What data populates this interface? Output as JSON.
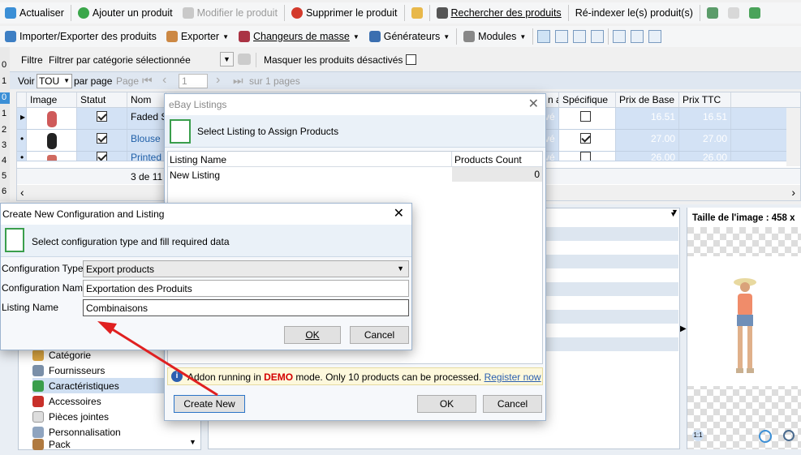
{
  "toolbar1": {
    "refresh": "Actualiser",
    "add": "Ajouter un produit",
    "edit": "Modifier le produit",
    "delete": "Supprimer le produit",
    "search": "Rechercher des produits",
    "reindex": "Ré-indexer le(s) produit(s)"
  },
  "toolbar2": {
    "import_export": "Importer/Exporter des produits",
    "export": "Exporter",
    "mass": "Changeurs de masse",
    "generators": "Générateurs",
    "modules": "Modules"
  },
  "filter": {
    "label": "Filtre",
    "value": "Filtrer par catégorie sélectionnée",
    "hide_disabled": "Masquer les produits désactivés"
  },
  "pager": {
    "show": "Voir",
    "per_value": "TOU",
    "per_page": "par page",
    "page_label": "Page",
    "page_value": "1",
    "of_pages": "sur 1 pages"
  },
  "grid": {
    "columns": [
      "Image",
      "Statut",
      "Nom",
      "n avancée des sto",
      "Spécifique",
      "Prix de Base",
      "Prix TTC"
    ],
    "rows": [
      {
        "name": "Faded Sh",
        "state": "vé",
        "spec": false,
        "base": "16.51",
        "ttc": "16.51"
      },
      {
        "name": "Blouse",
        "state": "vé",
        "spec": true,
        "base": "27.00",
        "ttc": "27.00"
      },
      {
        "name": "Printed D",
        "state": "vé",
        "spec": false,
        "base": "26.00",
        "ttc": "26.00"
      }
    ],
    "footer": "3 de 11 P",
    "left_nums": [
      "0",
      "1",
      "0",
      "1",
      "2",
      "3",
      "4",
      "5",
      "6"
    ]
  },
  "ebay": {
    "title": "eBay Listings",
    "header": "Select Listing to Assign Products",
    "col_name": "Listing Name",
    "col_count": "Products Count",
    "row_name": "New Listing",
    "row_count": "0",
    "notice_pre": "Addon running in ",
    "notice_demo": "DEMO",
    "notice_post": " mode. Only 10 products can be processed.",
    "notice_link": "Register now",
    "create_new": "Create New",
    "ok": "OK",
    "cancel": "Cancel"
  },
  "config": {
    "title": "Create New Configuration and Listing",
    "header": "Select configuration type and fill required data",
    "type_label": "Configuration Type",
    "type_value": "Export products",
    "name_label": "Configuration Name",
    "name_value": "Exportation des Produits",
    "listing_label": "Listing Name",
    "listing_value": "Combinaisons",
    "ok": "OK",
    "cancel": "Cancel"
  },
  "sidebar": {
    "items": [
      "Catégorie",
      "Fournisseurs",
      "Caractéristiques",
      "Accessoires",
      "Pièces jointes",
      "Personnalisation",
      "Pack"
    ]
  },
  "preview": {
    "title": "Taille de l'image : 458 x"
  },
  "colors": {
    "accent": "#2b74c7",
    "selection": "#d3e2f5",
    "demo": "#d40000",
    "arrow": "#e02020"
  }
}
